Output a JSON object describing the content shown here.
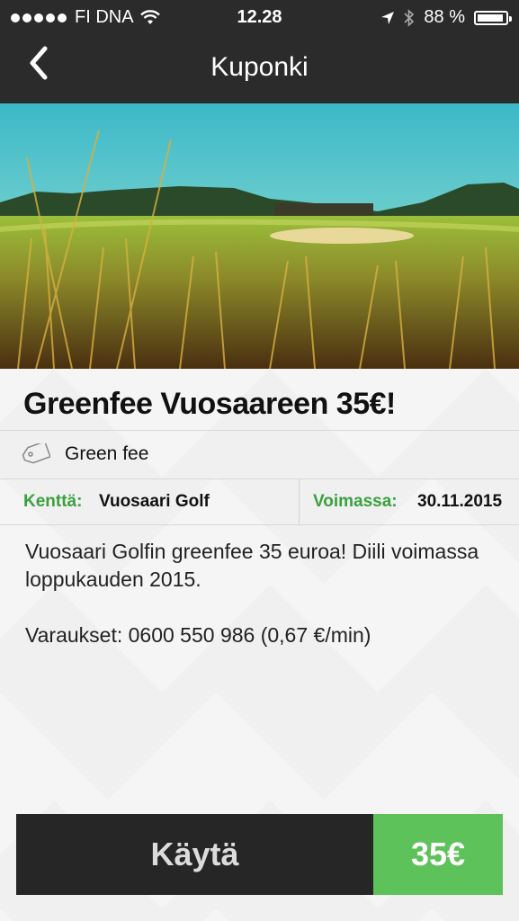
{
  "status_bar": {
    "carrier": "FI DNA",
    "time": "12.28",
    "battery": "88 %",
    "battery_level": 0.88
  },
  "header": {
    "title": "Kuponki"
  },
  "coupon": {
    "title": "Greenfee Vuosaareen 35€!",
    "category": "Green fee",
    "course_label": "Kenttä:",
    "course_value": "Vuosaari Golf",
    "valid_label": "Voimassa:",
    "valid_value": "30.11.2015",
    "description_line1": "Vuosaari Golfin greenfee 35 euroa! Diili voimassa loppukauden 2015.",
    "description_line2": "Varaukset: 0600 550 986 (0,67 €/min)"
  },
  "action": {
    "use_label": "Käytä",
    "price": "35€"
  },
  "colors": {
    "topbar": "#2b2b2b",
    "accent_green": "#5ec25a",
    "label_green": "#3aa13d",
    "button_dark": "#262626"
  }
}
